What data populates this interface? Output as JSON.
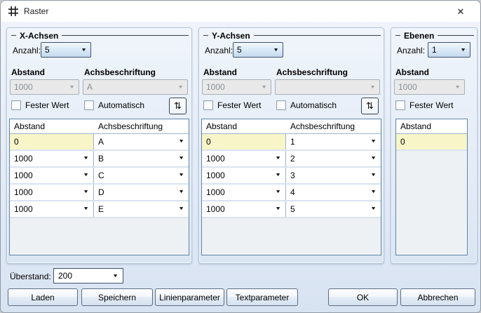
{
  "window": {
    "title": "Raster"
  },
  "icons": {
    "close": "✕",
    "swap": "⇅",
    "dropdown": "▼"
  },
  "colors": {
    "selected_cell": "#f8f6c8",
    "table_border": "#5f85ac",
    "group_border": "#b3c3d9",
    "combo_border": "#3e5270"
  },
  "groups": [
    {
      "title": "X-Achsen",
      "anzahl_label": "Anzahl:",
      "anzahl_value": "5",
      "col1_header": "Abstand",
      "col2_header": "Achsbeschriftung",
      "disabled_abstand": "1000",
      "disabled_label": "A",
      "fester_wert_label": "Fester Wert",
      "automatisch_label": "Automatisch",
      "table_col1": "Abstand",
      "table_col2": "Achsbeschriftung",
      "rows": [
        {
          "abstand": "0",
          "label": "A"
        },
        {
          "abstand": "1000",
          "label": "B"
        },
        {
          "abstand": "1000",
          "label": "C"
        },
        {
          "abstand": "1000",
          "label": "D"
        },
        {
          "abstand": "1000",
          "label": "E"
        }
      ]
    },
    {
      "title": "Y-Achsen",
      "anzahl_label": "Anzahl:",
      "anzahl_value": "5",
      "col1_header": "Abstand",
      "col2_header": "Achsbeschriftung",
      "disabled_abstand": "1000",
      "disabled_label": "",
      "fester_wert_label": "Fester Wert",
      "automatisch_label": "Automatisch",
      "table_col1": "Abstand",
      "table_col2": "Achsbeschriftung",
      "rows": [
        {
          "abstand": "0",
          "label": "1"
        },
        {
          "abstand": "1000",
          "label": "2"
        },
        {
          "abstand": "1000",
          "label": "3"
        },
        {
          "abstand": "1000",
          "label": "4"
        },
        {
          "abstand": "1000",
          "label": "5"
        }
      ]
    },
    {
      "title": "Ebenen",
      "anzahl_label": "Anzahl:",
      "anzahl_value": "1",
      "col1_header": "Abstand",
      "disabled_abstand": "1000",
      "fester_wert_label": "Fester Wert",
      "table_col1": "Abstand",
      "rows": [
        {
          "abstand": "0"
        }
      ]
    }
  ],
  "footer": {
    "ueberstand_label": "Überstand:",
    "ueberstand_value": "200",
    "laden": "Laden",
    "speichern": "Speichern",
    "linienparameter": "Linienparameter",
    "textparameter": "Textparameter",
    "ok": "OK",
    "abbrechen": "Abbrechen"
  }
}
